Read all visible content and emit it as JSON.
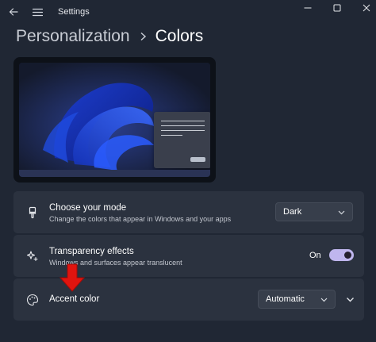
{
  "window": {
    "title": "Settings",
    "back_icon": "arrow-left-icon",
    "menu_icon": "hamburger-icon",
    "controls": [
      "minimize-icon",
      "maximize-icon",
      "close-icon"
    ]
  },
  "breadcrumb": {
    "parent": "Personalization",
    "current": "Colors"
  },
  "settings": {
    "mode": {
      "title": "Choose your mode",
      "description": "Change the colors that appear in Windows and your apps",
      "value": "Dark",
      "icon": "paintbrush-icon"
    },
    "transparency": {
      "title": "Transparency effects",
      "description": "Windows and surfaces appear translucent",
      "state_label": "On",
      "enabled": true,
      "icon": "sparkle-icon"
    },
    "accent": {
      "title": "Accent color",
      "value": "Automatic",
      "icon": "palette-icon"
    }
  },
  "colors": {
    "background": "#202734",
    "card": "#2b323f",
    "toggle_on": "#bfb6ee",
    "annotation_arrow": "#e0140f"
  }
}
